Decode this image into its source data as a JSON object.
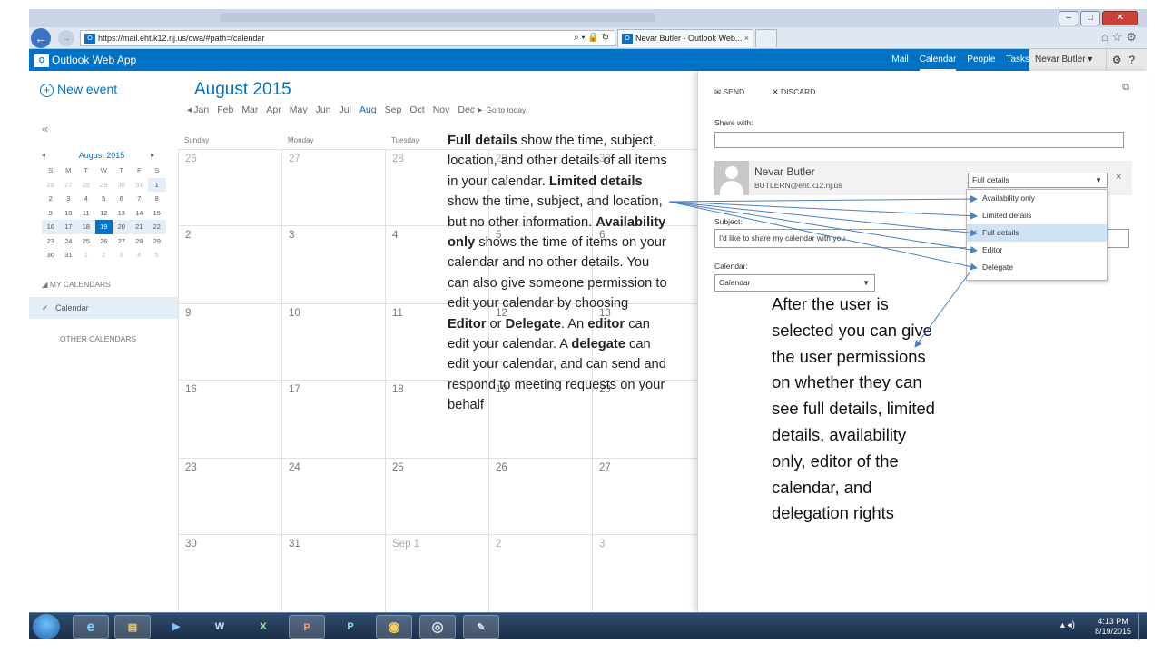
{
  "browser": {
    "url": "https://mail.eht.k12.nj.us/owa/#path=/calendar",
    "url_host_bold": "k12.nj.us",
    "tab_title": "Nevar Butler - Outlook Web...",
    "tab_badge": "O",
    "url_tools": "⌕ ▾ 🔒 ↻",
    "tab_close": "×"
  },
  "app": {
    "title": "Outlook Web App",
    "logo": "O",
    "nav": [
      "Mail",
      "Calendar",
      "People",
      "Tasks"
    ],
    "user": "Nevar Butler ▾",
    "gear": "⚙",
    "help": "?"
  },
  "left": {
    "new_event": "New event",
    "collapse": "«",
    "mini_month": "August 2015",
    "dow": [
      "S",
      "M",
      "T",
      "W",
      "T",
      "F",
      "S"
    ],
    "weeks": [
      [
        "26",
        "27",
        "28",
        "29",
        "30",
        "31",
        "1"
      ],
      [
        "2",
        "3",
        "4",
        "5",
        "6",
        "7",
        "8"
      ],
      [
        "9",
        "10",
        "11",
        "12",
        "13",
        "14",
        "15"
      ],
      [
        "16",
        "17",
        "18",
        "19",
        "20",
        "21",
        "22"
      ],
      [
        "23",
        "24",
        "25",
        "26",
        "27",
        "28",
        "29"
      ],
      [
        "30",
        "31",
        "1",
        "2",
        "3",
        "4",
        "5"
      ]
    ],
    "today": "19",
    "my_calendars": "MY CALENDARS",
    "calendar_item": "Calendar",
    "other_calendars": "OTHER CALENDARS"
  },
  "main": {
    "month_title": "August 2015",
    "months": [
      "Jan",
      "Feb",
      "Mar",
      "Apr",
      "May",
      "Jun",
      "Jul",
      "Aug",
      "Sep",
      "Oct",
      "Nov",
      "Dec"
    ],
    "current_month": "Aug",
    "go_to_today": "Go to today",
    "day_headers": [
      "Sunday",
      "Monday",
      "Tuesday"
    ],
    "rows": [
      [
        "26",
        "27",
        "28",
        "29",
        "30"
      ],
      [
        "2",
        "3",
        "4",
        "5",
        "6"
      ],
      [
        "9",
        "10",
        "11",
        "12",
        "13"
      ],
      [
        "16",
        "17",
        "18",
        "19",
        "20"
      ],
      [
        "23",
        "24",
        "25",
        "26",
        "27"
      ],
      [
        "30",
        "31",
        "Sep 1",
        "2",
        "3"
      ]
    ]
  },
  "panel": {
    "send": "SEND",
    "discard": "DISCARD",
    "share_with": "Share with:",
    "user_name": "Nevar Butler",
    "user_email": "BUTLERN@eht.k12.nj.us",
    "permission_value": "Full details",
    "remove": "×",
    "options": [
      "Availability only",
      "Limited details",
      "Full details",
      "Editor",
      "Delegate"
    ],
    "selected_option": "Full details",
    "subject_label": "Subject:",
    "subject_value": "I'd like to share my calendar with you",
    "calendar_label": "Calendar:",
    "calendar_value": "Calendar"
  },
  "callout_left": {
    "p1_b": "Full details",
    "p1": " show the time, subject, location, and other details of all items in your calendar. ",
    "p2_b": "Limited details",
    "p2": " show the time, subject, and location, but no other information. ",
    "p3_b": "Availability only",
    "p3": " shows the time of items on your calendar and no other details. You can also give someone permission to edit your calendar by choosing ",
    "p4_b": "Editor",
    "p4": " or ",
    "p5_b": "Delegate",
    "p5": ". An ",
    "p6_b": "editor",
    "p6": " can edit your calendar. A ",
    "p7_b": "delegate",
    "p7": " can edit your calendar, and can send and respond to meeting requests on your behalf"
  },
  "callout_right": "After the user is selected you can give the user permissions on whether they can see full details, limited details, availability only, editor of the calendar, and delegation rights",
  "taskbar": {
    "time": "4:13 PM",
    "date": "8/19/2015",
    "apps": [
      "e",
      "▤",
      "▶",
      "W",
      "X",
      "P",
      "P",
      "◉",
      "◎",
      "✎"
    ],
    "tray": "▴ ◂)"
  },
  "colors": {
    "owa_blue": "#0072c6",
    "arrow_blue": "#4a7fc1",
    "taskbar": "#1b2f48"
  }
}
